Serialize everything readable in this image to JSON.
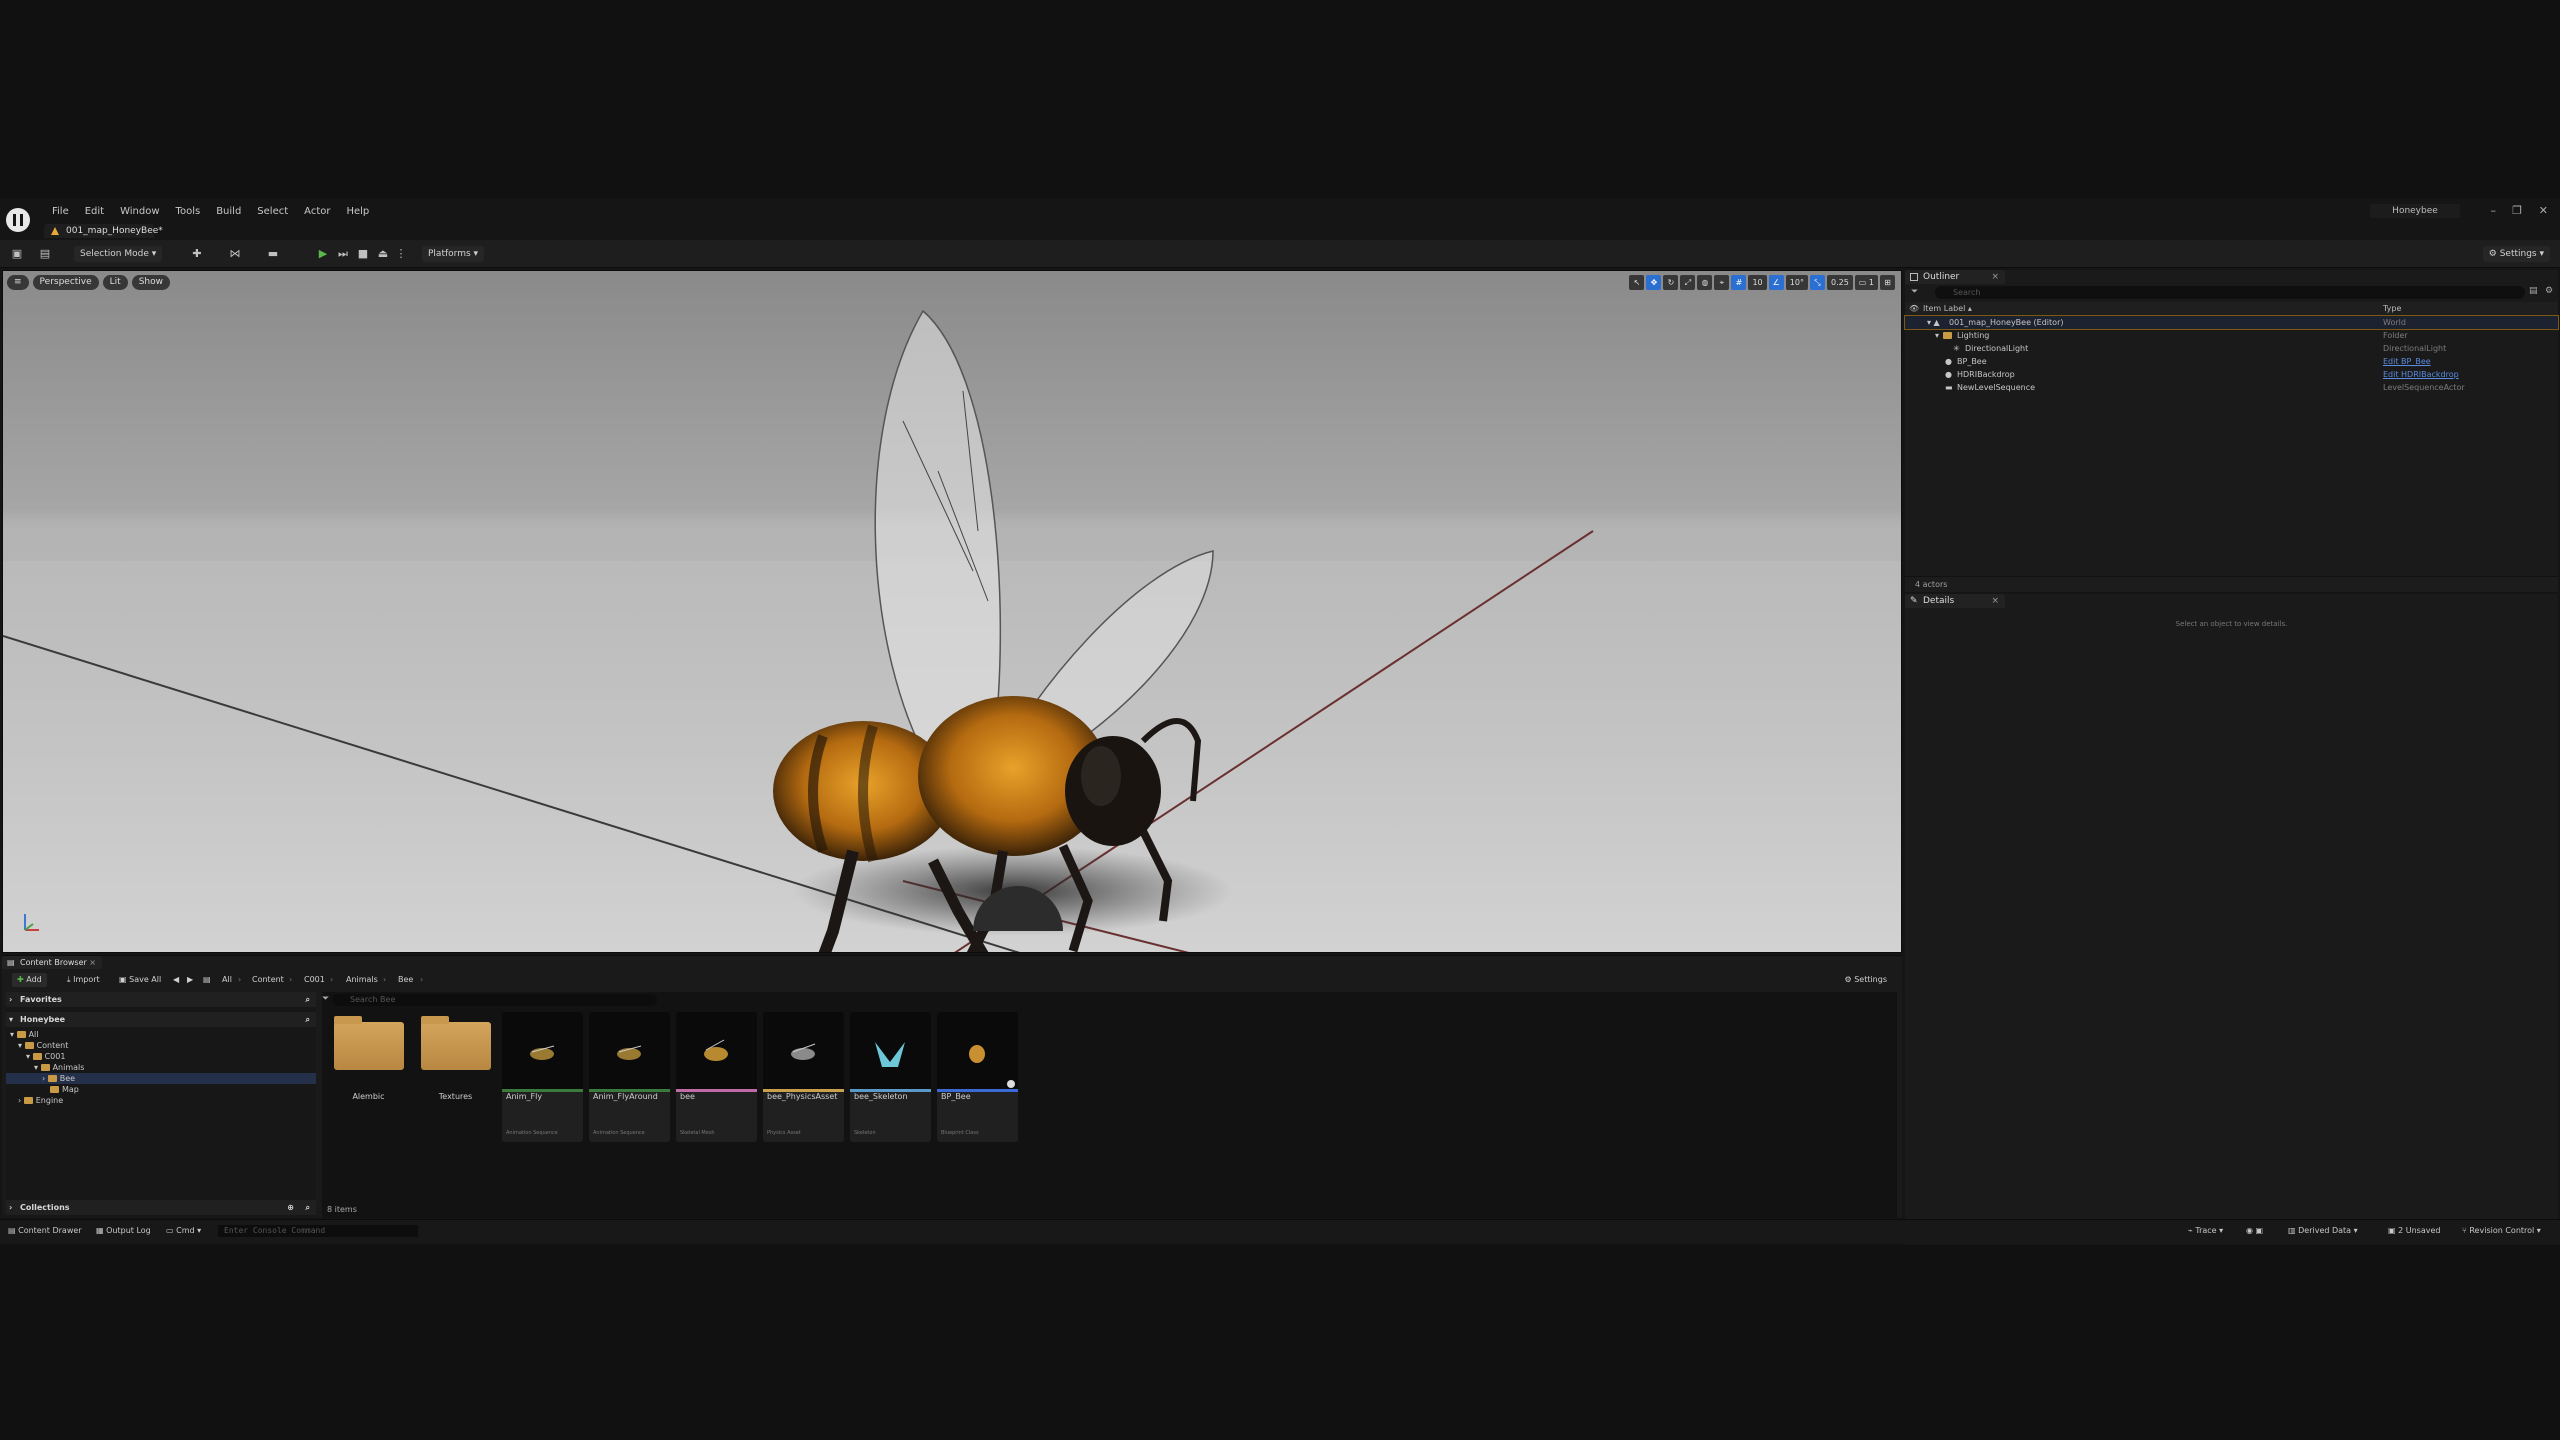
{
  "menubar": {
    "items": [
      "File",
      "Edit",
      "Window",
      "Tools",
      "Build",
      "Select",
      "Actor",
      "Help"
    ],
    "project": "Honeybee"
  },
  "level_tab": "001_map_HoneyBee*",
  "toolbar": {
    "selection_mode": "Selection Mode",
    "platforms": "Platforms",
    "settings": "Settings"
  },
  "viewport": {
    "perspective": "Perspective",
    "lit": "Lit",
    "show": "Show",
    "grid_snap": "10",
    "rotation_snap": "10°",
    "scale_snap": "0.25",
    "camera_speed": "1"
  },
  "outliner": {
    "tab": "Outliner",
    "search_placeholder": "Search",
    "col_label": "Item Label ▴",
    "col_type": "Type",
    "rows": [
      {
        "label": "001_map_HoneyBee (Editor)",
        "type": "World"
      },
      {
        "label": "Lighting",
        "type": "Folder"
      },
      {
        "label": "DirectionalLight",
        "type": "DirectionalLight"
      },
      {
        "label": "BP_Bee",
        "type": "Edit BP_Bee"
      },
      {
        "label": "HDRIBackdrop",
        "type": "Edit HDRIBackdrop"
      },
      {
        "label": "NewLevelSequence",
        "type": "LevelSequenceActor"
      }
    ],
    "footer": "4 actors"
  },
  "details": {
    "tab": "Details",
    "empty": "Select an object to view details."
  },
  "content_browser": {
    "tab": "Content Browser",
    "add": "Add",
    "import": "Import",
    "save_all": "Save All",
    "settings": "Settings",
    "breadcrumbs": [
      "All",
      "Content",
      "C001",
      "Animals",
      "Bee"
    ],
    "favorites": "Favorites",
    "project_root": "Honeybee",
    "tree": [
      "All",
      "Content",
      "C001",
      "Animals",
      "Bee",
      "Map",
      "Engine"
    ],
    "collections": "Collections",
    "search_placeholder": "Search Bee",
    "assets": [
      {
        "name": "Alembic",
        "kind": "folder",
        "sub": ""
      },
      {
        "name": "Textures",
        "kind": "folder",
        "sub": ""
      },
      {
        "name": "Anim_Fly",
        "kind": "file",
        "sub": "Animation Sequence",
        "color": "#3a7a3a"
      },
      {
        "name": "Anim_FlyAround",
        "kind": "file",
        "sub": "Animation Sequence",
        "color": "#3a7a3a"
      },
      {
        "name": "bee",
        "kind": "file",
        "sub": "Skeletal Mesh",
        "color": "#c06aa8"
      },
      {
        "name": "bee_PhysicsAsset",
        "kind": "file",
        "sub": "Physics Asset",
        "color": "#c9a04a"
      },
      {
        "name": "bee_Skeleton",
        "kind": "file",
        "sub": "Skeleton",
        "color": "#5a9ac8"
      },
      {
        "name": "BP_Bee",
        "kind": "file",
        "sub": "Blueprint Class",
        "color": "#3a6ad6"
      }
    ],
    "item_count": "8 items"
  },
  "statusbar": {
    "content_drawer": "Content Drawer",
    "output_log": "Output Log",
    "cmd": "Cmd",
    "console_placeholder": "Enter Console Command",
    "trace": "Trace",
    "derived_data": "Derived Data",
    "unsaved": "2 Unsaved",
    "revision_control": "Revision Control"
  },
  "colors": {
    "accent": "#2a6fd1",
    "folder": "#c99a45",
    "play": "#5ab84a"
  }
}
